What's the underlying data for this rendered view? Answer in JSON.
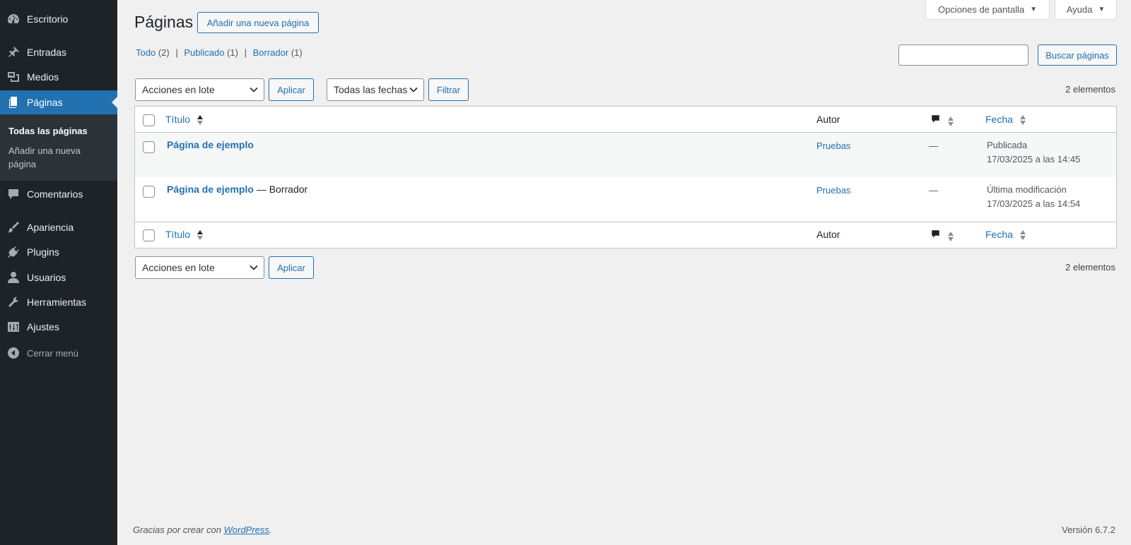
{
  "sidebar": {
    "items": [
      {
        "label": "Escritorio",
        "icon": "dashboard-icon"
      },
      {
        "label": "Entradas",
        "icon": "pin-icon"
      },
      {
        "label": "Medios",
        "icon": "media-icon"
      },
      {
        "label": "Páginas",
        "icon": "page-icon"
      },
      {
        "label": "Comentarios",
        "icon": "comment-icon"
      },
      {
        "label": "Apariencia",
        "icon": "brush-icon"
      },
      {
        "label": "Plugins",
        "icon": "plugin-icon"
      },
      {
        "label": "Usuarios",
        "icon": "user-icon"
      },
      {
        "label": "Herramientas",
        "icon": "wrench-icon"
      },
      {
        "label": "Ajustes",
        "icon": "settings-icon"
      }
    ],
    "submenu": {
      "all_pages": "Todas las páginas",
      "add_new": "Añadir una nueva",
      "add_new_2": "página"
    },
    "collapse_label": "Cerrar menú"
  },
  "header": {
    "title": "Páginas",
    "add_new_button": "Añadir una nueva página",
    "screen_options": "Opciones de pantalla",
    "help": "Ayuda"
  },
  "filters": {
    "all_label": "Todo",
    "all_count": "(2)",
    "published_label": "Publicado",
    "published_count": "(1)",
    "draft_label": "Borrador",
    "draft_count": "(1)",
    "separator": "|"
  },
  "search": {
    "value": "",
    "button": "Buscar páginas"
  },
  "tablenav": {
    "bulk_actions": "Acciones en lote",
    "apply": "Aplicar",
    "all_dates": "Todas las fechas",
    "filter": "Filtrar",
    "items_count": "2 elementos"
  },
  "table": {
    "columns": {
      "title": "Título",
      "author": "Autor",
      "date": "Fecha"
    },
    "rows": [
      {
        "title": "Página de ejemplo",
        "state": "",
        "author": "Pruebas",
        "comments": "—",
        "date_status": "Publicada",
        "date": "17/03/2025 a las 14:45"
      },
      {
        "title": "Página de ejemplo",
        "state": "— Borrador",
        "author": "Pruebas",
        "comments": "—",
        "date_status": "Última modificación",
        "date": "17/03/2025 a las 14:54"
      }
    ]
  },
  "footer": {
    "thanks_prefix": "Gracias por crear con",
    "wordpress_link": "WordPress",
    "thanks_suffix": ".",
    "version": "Versión 6.7.2"
  },
  "colors": {
    "sidebar_bg": "#1d2327",
    "accent": "#2271b1",
    "page_bg": "#f0f0f1"
  }
}
